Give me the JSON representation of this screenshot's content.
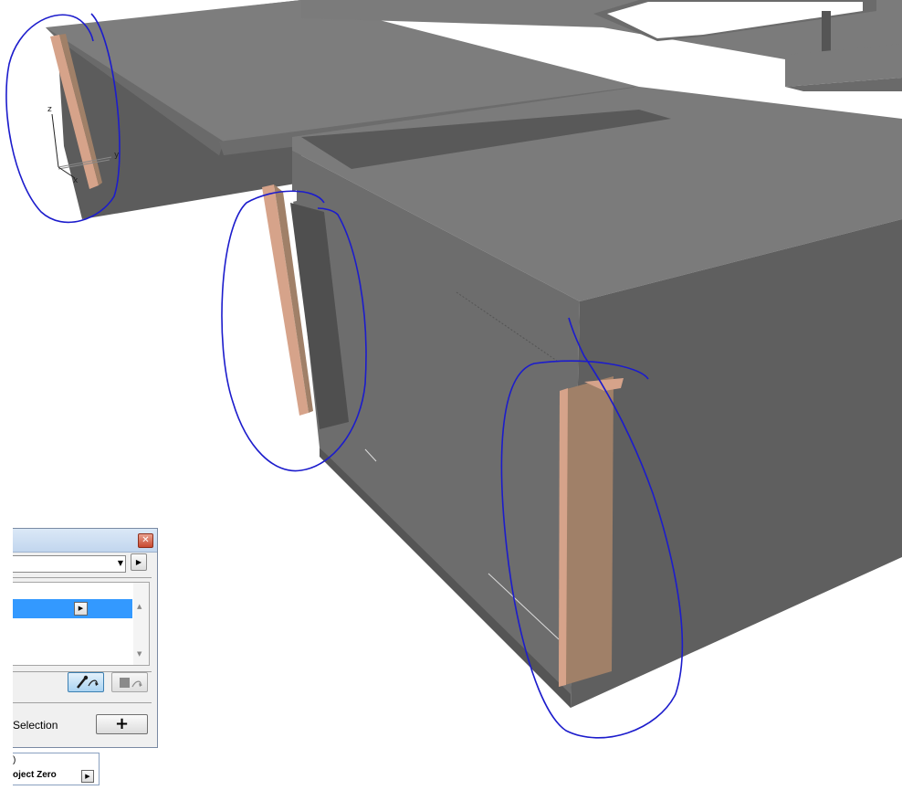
{
  "scene": {
    "axis_labels": {
      "z": "z",
      "y": "y",
      "x": "x"
    }
  },
  "palette": {
    "close_glyph": "✕",
    "dropdown_arrow": "▼",
    "dropdown_button_glyph": "▶",
    "list_row_button_glyph": "▶",
    "scroll_up_glyph": "▲",
    "scroll_down_glyph": "▼",
    "pick_settings_icon": "eyedropper-icon",
    "inject_settings_icon": "syringe-icon",
    "selection_label": "Selection",
    "add_button_label": "+"
  },
  "info_box": {
    "top_text": ")",
    "bottom_text": "oject Zero",
    "button_glyph": "▶"
  },
  "colors": {
    "slab_top": "#7b7b7b",
    "wall_dark": "#5e5e5e",
    "wall_mid": "#6c6c6c",
    "board_face": "#a08068",
    "board_edge": "#d6a38a",
    "annotation": "#1c1ccc",
    "selection_blue": "#3399ff"
  }
}
